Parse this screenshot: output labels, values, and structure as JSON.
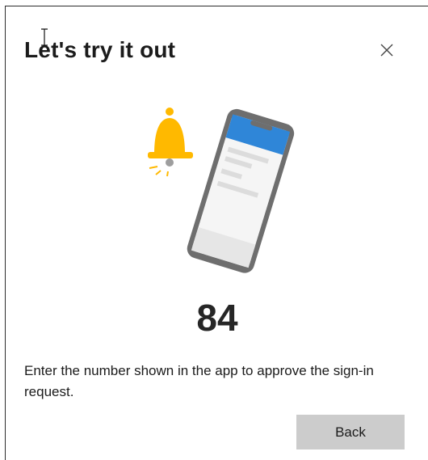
{
  "dialog": {
    "title": "Let's try it out",
    "close_icon": "close-icon",
    "number": "84",
    "instructions": "Enter the number shown in the app to approve the sign-in request.",
    "back_label": "Back"
  },
  "illustration": {
    "bell_icon": "notification-bell-icon",
    "phone_icon": "phone-icon",
    "colors": {
      "bell": "#ffb900",
      "phone_header": "#2f86d8",
      "phone_frame": "#6e6e6e"
    }
  }
}
